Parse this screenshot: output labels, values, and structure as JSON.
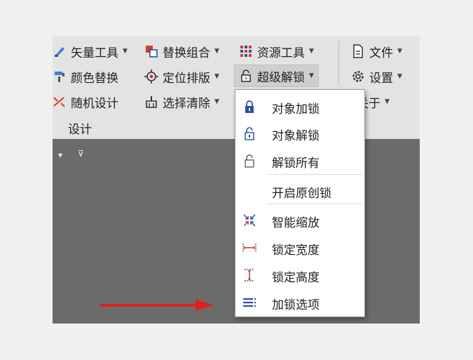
{
  "ribbon": {
    "vector_tools": "矢量工具",
    "replace_combo": "替换组合",
    "resource_tools": "资源工具",
    "file": "文件",
    "color_replace": "颜色替换",
    "position_layout": "定位排版",
    "super_unlock": "超级解锁",
    "settings": "设置",
    "random_design": "随机设计",
    "select_clear": "选择清除",
    "about": "关于",
    "group_label": "设计"
  },
  "menu": {
    "items": [
      {
        "label": "对象加锁",
        "icon": "lock-closed-icon"
      },
      {
        "label": "对象解锁",
        "icon": "lock-open-icon"
      },
      {
        "label": "解锁所有",
        "icon": "lock-outline-icon"
      },
      {
        "label": "开启原创锁",
        "icon": ""
      },
      {
        "label": "智能缩放",
        "icon": "smart-zoom-icon"
      },
      {
        "label": "锁定宽度",
        "icon": "lock-width-icon"
      },
      {
        "label": "锁定高度",
        "icon": "lock-height-icon"
      },
      {
        "label": "加锁选项",
        "icon": "lock-options-icon"
      }
    ]
  },
  "colors": {
    "accent_blue": "#2c4fa0",
    "annotation_red": "#e02020",
    "ribbon_bg": "#e3e3e3",
    "canvas_dark": "#6b6b6b"
  }
}
